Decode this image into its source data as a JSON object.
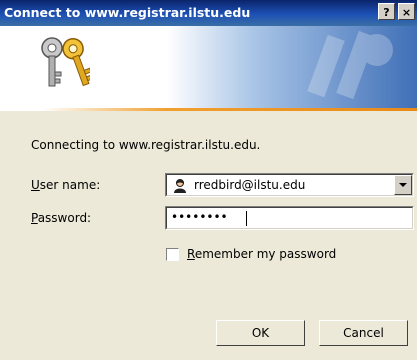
{
  "dialog": {
    "title": "Connect to www.registrar.ilstu.edu",
    "help_button": "?",
    "close_button": "×",
    "message": "Connecting to www.registrar.ilstu.edu.",
    "username_label_u": "U",
    "username_label_rest": "ser name:",
    "username_value": "rredbird@ilstu.edu",
    "password_label_p": "P",
    "password_label_rest": "assword:",
    "password_value": "••••••••",
    "remember_label_r": "R",
    "remember_label_rest": "emember my password",
    "remember_checked": false,
    "ok_label": "OK",
    "cancel_label": "Cancel"
  },
  "icons": [
    "keys-icon",
    "user-icon",
    "dropdown-arrow-icon",
    "help-icon",
    "close-icon"
  ],
  "colors": {
    "title_bar": "#0a246a",
    "accent_line": "#e88a18",
    "dialog_bg": "#ece9d8"
  }
}
